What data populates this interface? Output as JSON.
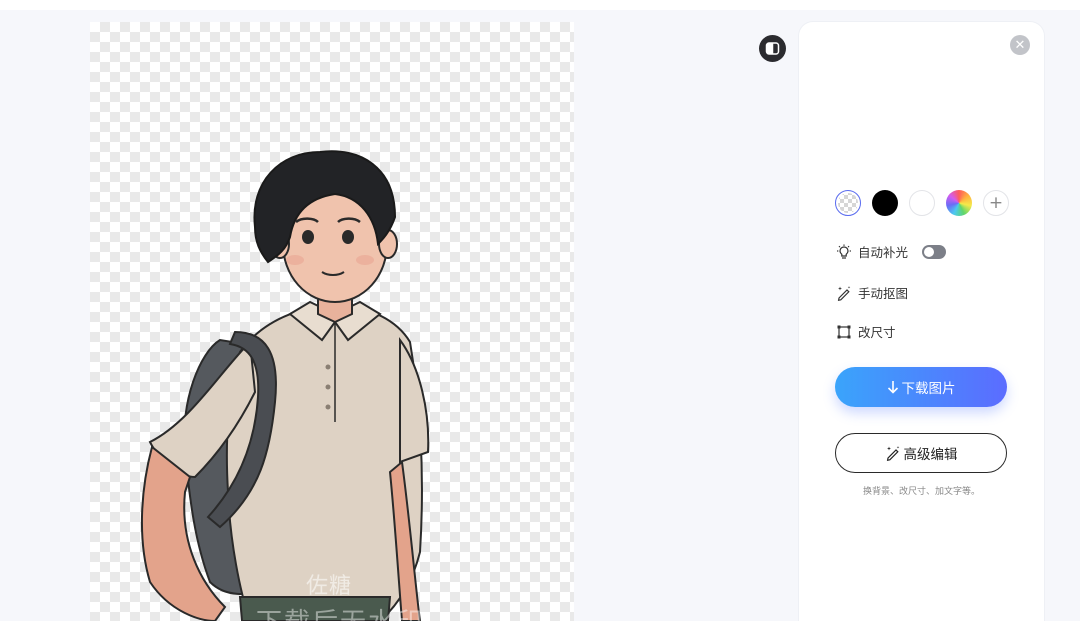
{
  "canvas": {
    "watermark_line1": "佐糖",
    "watermark_line2": "下载后无水印"
  },
  "panel": {
    "background_swatches": [
      {
        "name": "transparent",
        "selected": true
      },
      {
        "name": "black",
        "color": "#000000"
      },
      {
        "name": "white",
        "color": "#ffffff"
      },
      {
        "name": "rainbow-picker"
      },
      {
        "name": "add-custom",
        "label": "+"
      }
    ],
    "auto_light_label": "自动补光",
    "auto_light_on": false,
    "manual_cutout_label": "手动抠图",
    "resize_label": "改尺寸",
    "download_label": "下载图片",
    "advanced_edit_label": "高级编辑",
    "advanced_hint": "换背景、改尺寸、加文字等。"
  },
  "colors": {
    "accent_start": "#3aa4fb",
    "accent_end": "#5b6cff",
    "selected_ring": "#5a6cf0"
  }
}
